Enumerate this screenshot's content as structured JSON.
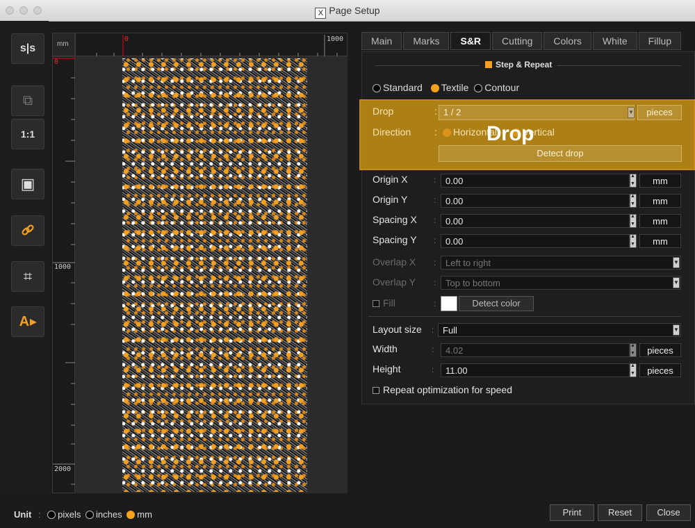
{
  "window": {
    "title": "Page Setup",
    "title_icon": "X"
  },
  "toolbar": [
    {
      "name": "tool-mirror",
      "glyph": "s|s"
    },
    {
      "name": "tool-export",
      "glyph": "⧉"
    },
    {
      "name": "tool-actual-size",
      "glyph": "1:1"
    },
    {
      "name": "tool-fit",
      "glyph": "▣"
    },
    {
      "name": "tool-link",
      "glyph": "🔗"
    },
    {
      "name": "tool-frame",
      "glyph": "⌗"
    },
    {
      "name": "tool-text",
      "glyph": "A"
    }
  ],
  "ruler": {
    "unit": "mm",
    "h_zero": "0",
    "h_1000": "1000",
    "v_zero": "0",
    "v_1000": "1000",
    "v_2000": "2000"
  },
  "tabs": [
    {
      "label": "Main",
      "active": false
    },
    {
      "label": "Marks",
      "active": false
    },
    {
      "label": "S&R",
      "active": true
    },
    {
      "label": "Cutting",
      "active": false
    },
    {
      "label": "Colors",
      "active": false
    },
    {
      "label": "White",
      "active": false
    },
    {
      "label": "Fillup",
      "active": false
    }
  ],
  "step_repeat": {
    "title": "Step & Repeat",
    "mode_options": [
      "Standard",
      "Textile",
      "Contour"
    ],
    "mode_selected": "Textile",
    "drop": {
      "label": "Drop",
      "value": "1 / 2",
      "unit": "pieces"
    },
    "direction": {
      "label": "Direction",
      "options": [
        "Horizontal",
        "Vertical"
      ]
    },
    "detect_drop_label": "Detect drop",
    "overlay_label": "Drop",
    "origin_x": {
      "label": "Origin X",
      "value": "0.00",
      "unit": "mm"
    },
    "origin_y": {
      "label": "Origin Y",
      "value": "0.00",
      "unit": "mm"
    },
    "spacing_x": {
      "label": "Spacing X",
      "value": "0.00",
      "unit": "mm"
    },
    "spacing_y": {
      "label": "Spacing Y",
      "value": "0.00",
      "unit": "mm"
    },
    "overlap_x": {
      "label": "Overlap X",
      "value": "Left to right"
    },
    "overlap_y": {
      "label": "Overlap Y",
      "value": "Top to bottom"
    },
    "fill": {
      "label": "Fill",
      "detect_color_label": "Detect color"
    },
    "layout_size": {
      "label": "Layout size",
      "value": "Full"
    },
    "width": {
      "label": "Width",
      "value": "4.02",
      "unit": "pieces"
    },
    "height": {
      "label": "Height",
      "value": "11.00",
      "unit": "pieces"
    },
    "optimize_label": "Repeat optimization for speed"
  },
  "bottom": {
    "unit_label": "Unit",
    "unit_options": [
      "pixels",
      "inches",
      "mm"
    ],
    "unit_selected": "mm",
    "print_label": "Print",
    "reset_label": "Reset",
    "close_label": "Close"
  },
  "colors": {
    "accent": "#f0a028",
    "background": "#1b1b1b"
  }
}
